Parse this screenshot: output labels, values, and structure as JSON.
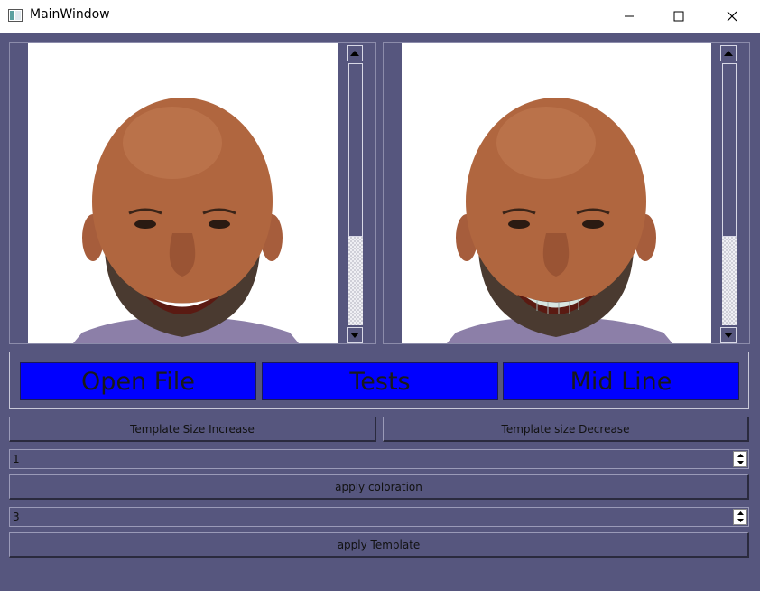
{
  "window": {
    "title": "MainWindow"
  },
  "icons": {
    "app": "app-window-icon",
    "minimize": "minimize-icon",
    "maximize": "maximize-icon",
    "close": "close-icon",
    "scroll_up": "scroll-up-arrow-icon",
    "scroll_down": "scroll-down-arrow-icon",
    "spin_up": "spin-up-arrow-icon",
    "spin_down": "spin-down-arrow-icon"
  },
  "viewers": [
    {
      "content": "face-photo-original"
    },
    {
      "content": "face-photo-with-template-teeth"
    }
  ],
  "buttons": {
    "open_file": "Open File",
    "tests": "Tests",
    "mid_line": "Mid Line",
    "template_increase": "Template Size Increase",
    "template_decrease": "Template size Decrease",
    "apply_coloration": "apply coloration",
    "apply_template": "apply Template"
  },
  "spinboxes": {
    "coloration_value": "1",
    "template_value": "3"
  },
  "colors": {
    "background": "#56567e",
    "action_button": "#0000ff",
    "photo_background": "#ffffff"
  }
}
